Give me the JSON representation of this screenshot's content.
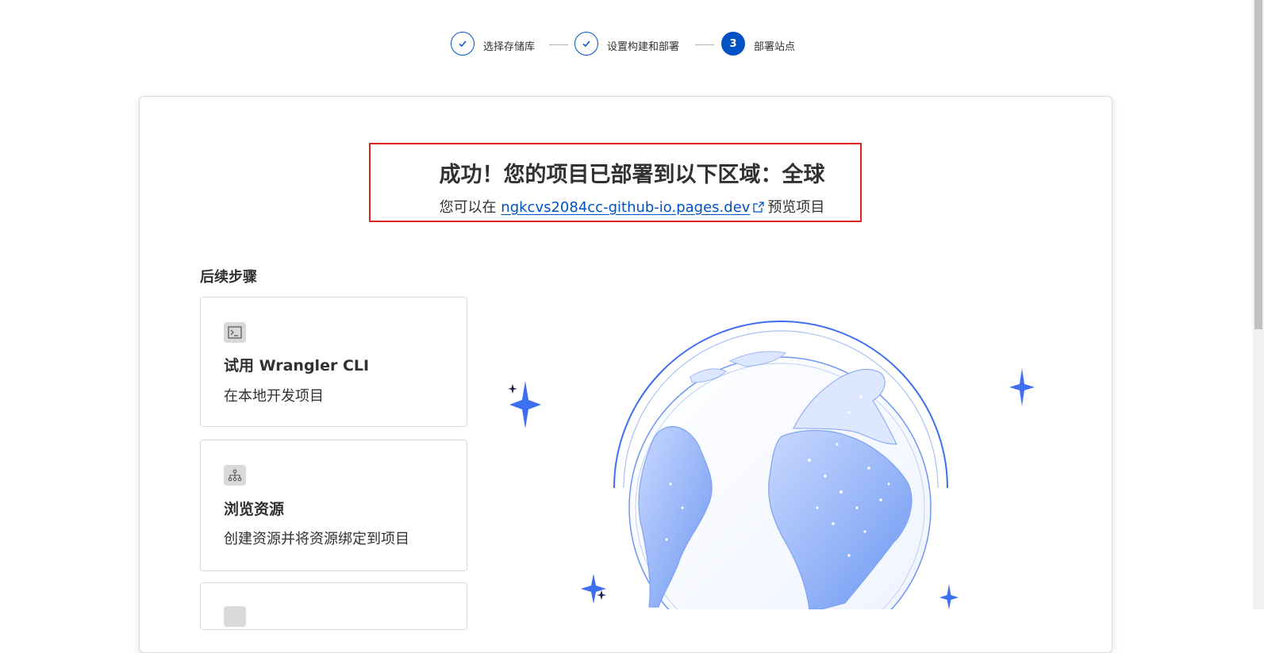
{
  "stepper": {
    "steps": [
      {
        "label": "选择存储库",
        "state": "done"
      },
      {
        "label": "设置构建和部署",
        "state": "done"
      },
      {
        "number": "3",
        "label": "部署站点",
        "state": "active"
      }
    ]
  },
  "success": {
    "title": "成功！您的项目已部署到以下区域：全球",
    "sub_prefix": "您可以在",
    "link_text": "ngkcvs2084cc-github-io.pages.dev",
    "sub_suffix": "预览项目"
  },
  "next_steps": {
    "title": "后续步骤",
    "cards": [
      {
        "icon": "terminal-icon",
        "title": "试用 Wrangler CLI",
        "desc": "在本地开发项目"
      },
      {
        "icon": "network-icon",
        "title": "浏览资源",
        "desc": "创建资源并将资源绑定到项目"
      }
    ]
  },
  "colors": {
    "accent": "#0051c3",
    "highlight_border": "#e02424",
    "globe_blue": "#6d97f2",
    "sparkle_blue": "#3e6ff0"
  }
}
